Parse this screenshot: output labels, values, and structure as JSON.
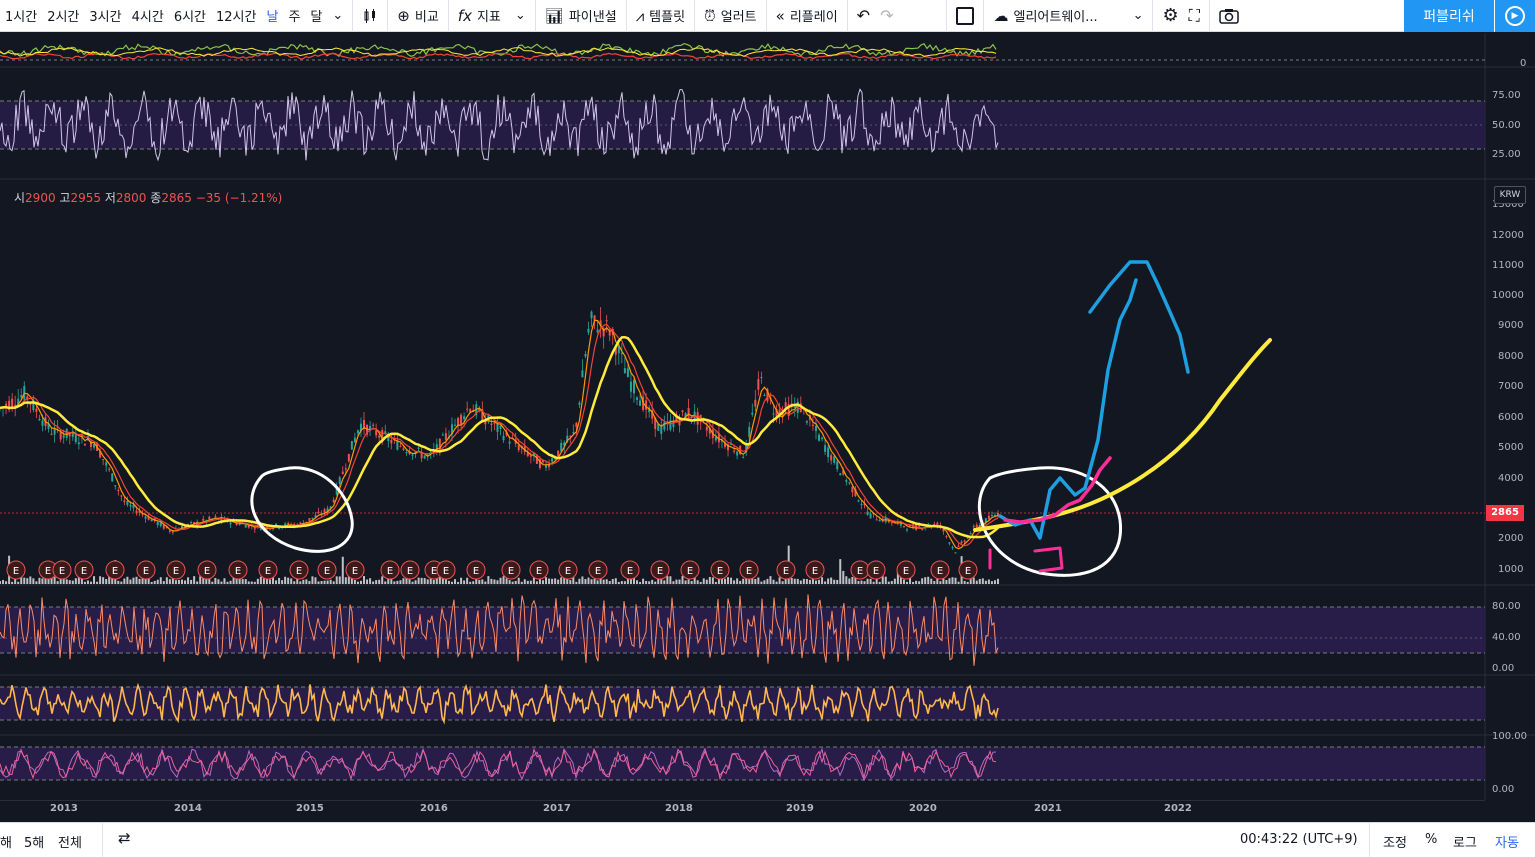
{
  "toolbar": {
    "intervals": [
      "1시간",
      "2시간",
      "3시간",
      "4시간",
      "6시간",
      "12시간",
      "날",
      "주",
      "달"
    ],
    "active_interval": "날",
    "compare_label": "비교",
    "indicators_label": "지표",
    "financials_label": "파이낸셜",
    "templates_label": "템플릿",
    "alert_label": "얼러트",
    "replay_label": "리플레이",
    "layout_name": "엘리어트웨이...",
    "publish_label": "퍼블리쉬"
  },
  "legend": {
    "open_label": "시",
    "open_value": "2900",
    "high_label": "고",
    "high_value": "2955",
    "low_label": "저",
    "low_value": "2800",
    "close_label": "종",
    "close_value": "2865",
    "change": "−35 (−1.21%)"
  },
  "currency": "KRW",
  "price_axis": {
    "ticks": [
      "13000",
      "12000",
      "11000",
      "10000",
      "9000",
      "8000",
      "7000",
      "6000",
      "5000",
      "4000",
      "3000",
      "2000",
      "1000"
    ],
    "last_price": "2865",
    "last_price_color": "#f23645"
  },
  "rsi_pane": {
    "ticks": [
      "75.00",
      "50.00",
      "25.00"
    ]
  },
  "top_pane": {
    "ticks": [
      "0"
    ]
  },
  "osc1_pane": {
    "ticks": [
      "80.00",
      "40.00",
      "0.00"
    ]
  },
  "osc3_pane": {
    "ticks": [
      "100.00",
      "0.00"
    ]
  },
  "time_axis": {
    "labels": [
      "2013",
      "2014",
      "2015",
      "2016",
      "2017",
      "2018",
      "2019",
      "2020",
      "2021",
      "2022"
    ]
  },
  "earnings_marker": "E",
  "bottom_bar": {
    "ranges": [
      "해",
      "5해",
      "전체"
    ],
    "clock": "00:43:22 (UTC+9)",
    "adjust_label": "조정",
    "percent_label": "%",
    "log_label": "로그",
    "auto_label": "자동"
  },
  "colors": {
    "background": "#131722",
    "ma_yellow": "#ffeb3b",
    "ma_red": "#f44336",
    "ma_orange": "#ff9800",
    "drawing_blue": "#1e9fe0",
    "drawing_magenta": "#ff2e97",
    "drawing_white": "#ffffff",
    "accent": "#2196f3"
  }
}
